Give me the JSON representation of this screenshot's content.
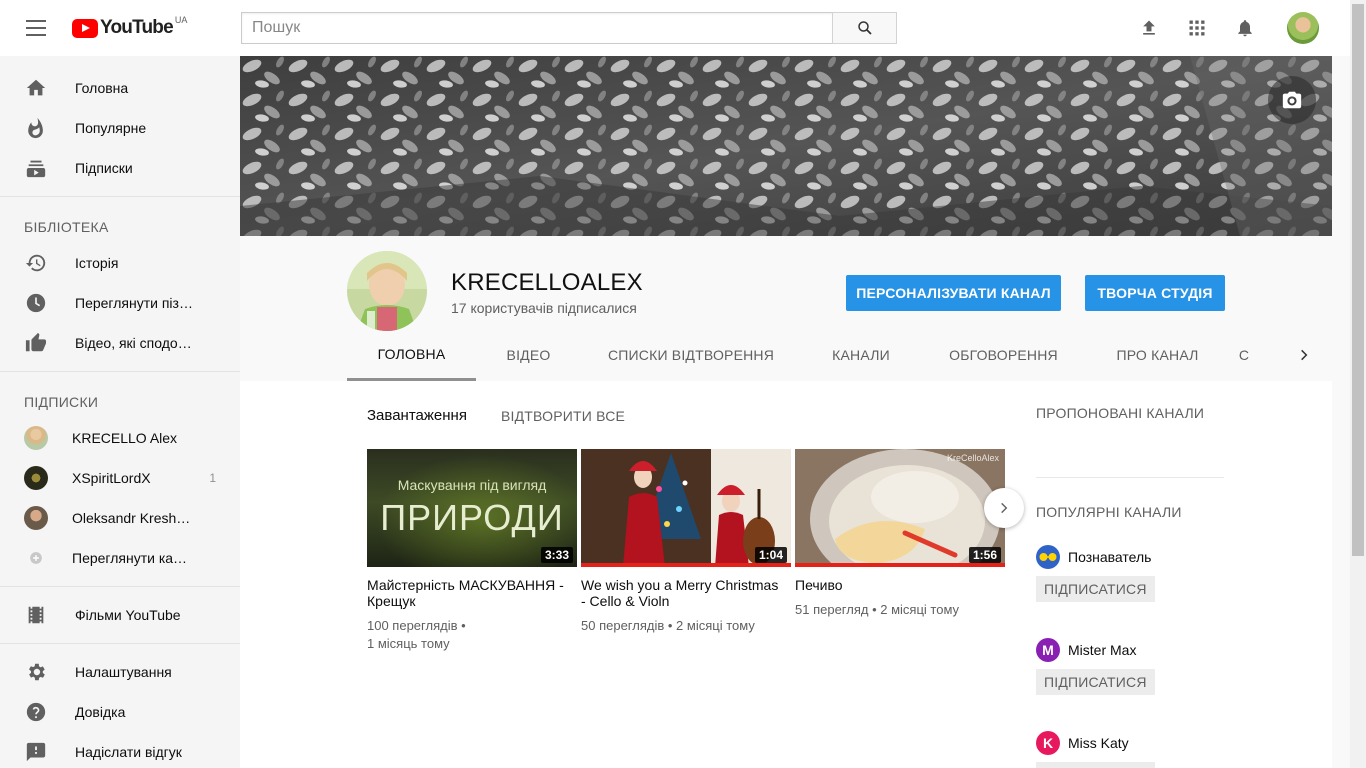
{
  "header": {
    "logo_text": "YouTube",
    "country_code": "UA",
    "search_placeholder": "Пошук"
  },
  "sidebar": {
    "main_items": [
      {
        "label": "Головна",
        "icon": "home-icon"
      },
      {
        "label": "Популярне",
        "icon": "fire-icon"
      },
      {
        "label": "Підписки",
        "icon": "subscriptions-icon"
      }
    ],
    "library_header": "БІБЛІОТЕКА",
    "library_items": [
      {
        "label": "Історія",
        "icon": "history-icon"
      },
      {
        "label": "Переглянути пізніше",
        "icon": "clock-icon"
      },
      {
        "label": "Відео, які сподобалися",
        "icon": "thumb-up-icon"
      }
    ],
    "subs_header": "ПІДПИСКИ",
    "subs_items": [
      {
        "label": "KRECELLO Alex",
        "count": ""
      },
      {
        "label": "XSpiritLordX",
        "count": "1"
      },
      {
        "label": "Oleksandr Kreshchuk",
        "count": ""
      },
      {
        "label": "Переглянути канали",
        "count": ""
      }
    ],
    "movies_label": "Фільми YouTube",
    "footer_items": [
      {
        "label": "Налаштування",
        "icon": "gear-icon"
      },
      {
        "label": "Довідка",
        "icon": "help-icon"
      },
      {
        "label": "Надіслати відгук",
        "icon": "feedback-icon"
      }
    ]
  },
  "channel": {
    "name": "KRECELLOALEX",
    "subscribers": "17 користувачів підписалися",
    "customize_button": "ПЕРСОНАЛІЗУВАТИ КАНАЛ",
    "studio_button": "ТВОРЧА СТУДІЯ",
    "tabs": [
      "ГОЛОВНА",
      "ВІДЕО",
      "СПИСКИ ВІДТВОРЕННЯ",
      "КАНАЛИ",
      "ОБГОВОРЕННЯ",
      "ПРО КАНАЛ",
      "С"
    ]
  },
  "shelf": {
    "title": "Завантаження",
    "play_all": "ВІДТВОРИТИ ВСЕ",
    "videos": [
      {
        "title": "Майстерність МАСКУВАННЯ - Крещук",
        "views": "100 переглядів",
        "age": "1 місяць тому",
        "duration": "3:33",
        "thumb_line1": "Маскування під вигляд",
        "thumb_line2": "ПРИРОДИ"
      },
      {
        "title": "We wish you a Merry Christmas - Cello & Violn",
        "views": "50 переглядів",
        "age": "2 місяці тому",
        "duration": "1:04"
      },
      {
        "title": "Печиво",
        "views": "51 перегляд",
        "age": "2 місяці тому",
        "duration": "1:56",
        "watermark": "KreCelloAlex"
      }
    ]
  },
  "right_column": {
    "suggested_header": "ПРОПОНОВАНІ КАНАЛИ",
    "popular_header": "ПОПУЛЯРНІ КАНАЛИ",
    "channels": [
      {
        "name": "Познаватель",
        "color": "#2f63c8"
      },
      {
        "name": "Mister Max",
        "color": "#8a1fb3"
      },
      {
        "name": "Miss Katy",
        "color": "#e8185f"
      }
    ],
    "subscribe_label": "ПІДПИСАТИСЯ"
  },
  "colors": {
    "accent_blue": "#2793e6",
    "youtube_red": "#ff0000",
    "progress_red": "#e62117"
  }
}
